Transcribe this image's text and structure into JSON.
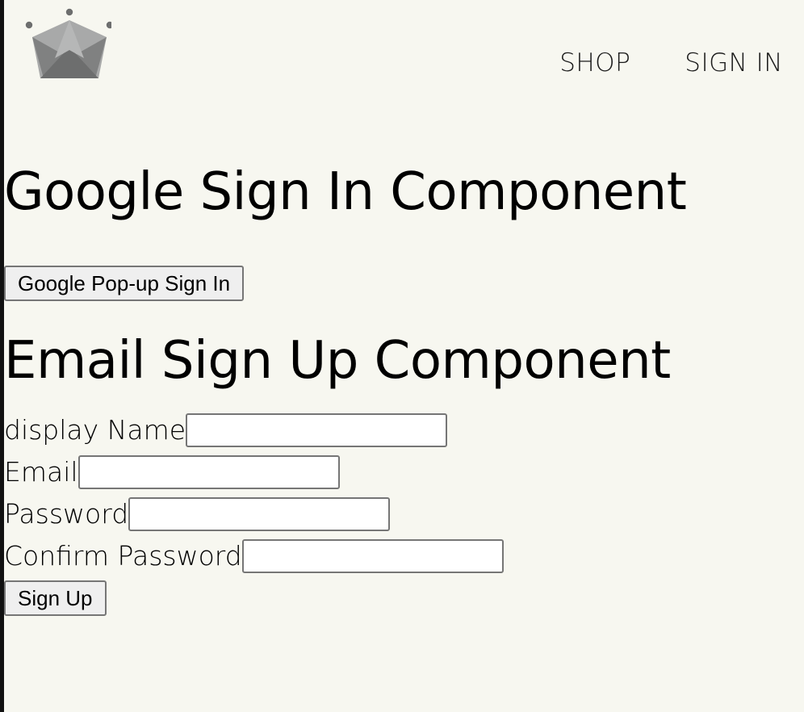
{
  "nav": {
    "logo_icon": "crown-icon",
    "links": [
      {
        "label": "SHOP"
      },
      {
        "label": "SIGN IN"
      }
    ]
  },
  "google_section": {
    "title": "Google Sign In Component",
    "button_label": "Google Pop-up Sign In"
  },
  "email_section": {
    "title": "Email Sign Up Component",
    "fields": [
      {
        "label": "display Name",
        "value": "",
        "type": "text"
      },
      {
        "label": "Email",
        "value": "",
        "type": "email"
      },
      {
        "label": "Password",
        "value": "",
        "type": "password"
      },
      {
        "label": "Confirm Password",
        "value": "",
        "type": "password"
      }
    ],
    "submit_label": "Sign Up"
  },
  "colors": {
    "background": "#f7f7f0",
    "crown_dark": "#6d6e6e",
    "crown_light": "#a8a9a9"
  }
}
